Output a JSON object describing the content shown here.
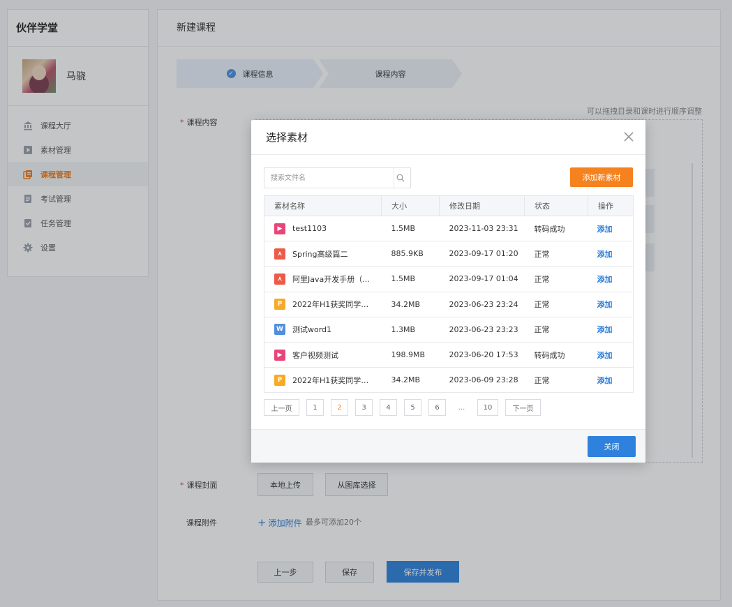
{
  "sidebar": {
    "app_title": "伙伴学堂",
    "username": "马骁",
    "items": [
      {
        "label": "课程大厅",
        "icon": "hall-icon",
        "active": false
      },
      {
        "label": "素材管理",
        "icon": "media-icon",
        "active": false
      },
      {
        "label": "课程管理",
        "icon": "course-icon",
        "active": true
      },
      {
        "label": "考试管理",
        "icon": "exam-icon",
        "active": false
      },
      {
        "label": "任务管理",
        "icon": "task-icon",
        "active": false
      },
      {
        "label": "设置",
        "icon": "gear-icon",
        "active": false
      }
    ]
  },
  "main": {
    "title": "新建课程",
    "steps": [
      "课程信息",
      "课程内容"
    ],
    "hint": "可以拖拽目录和课时进行顺序调整",
    "content_label": "课程内容",
    "cover_label": "课程封面",
    "cover_buttons": [
      "本地上传",
      "从图库选择"
    ],
    "attachment_label": "课程附件",
    "attachment_add": "添加附件",
    "attachment_note": "最多可添加20个",
    "prev_label": "上一步",
    "save_label": "保存",
    "publish_label": "保存并发布"
  },
  "modal": {
    "title": "选择素材",
    "search_placeholder": "搜索文件名",
    "add_button": "添加新素材",
    "columns": [
      "素材名称",
      "大小",
      "修改日期",
      "状态",
      "操作"
    ],
    "rows": [
      {
        "name": "test1103",
        "type": "video",
        "size": "1.5MB",
        "date": "2023-11-03 23:31",
        "status": "转码成功",
        "action": "添加"
      },
      {
        "name": "Spring高级篇二",
        "type": "pdf",
        "size": "885.9KB",
        "date": "2023-09-17 01:20",
        "status": "正常",
        "action": "添加"
      },
      {
        "name": "阿里Java开发手册（...",
        "type": "pdf",
        "size": "1.5MB",
        "date": "2023-09-17 01:04",
        "status": "正常",
        "action": "添加"
      },
      {
        "name": "2022年H1获奖同学事...",
        "type": "ppt",
        "size": "34.2MB",
        "date": "2023-06-23 23:24",
        "status": "正常",
        "action": "添加"
      },
      {
        "name": "测试word1",
        "type": "word",
        "size": "1.3MB",
        "date": "2023-06-23 23:23",
        "status": "正常",
        "action": "添加"
      },
      {
        "name": "客户视频测试",
        "type": "video",
        "size": "198.9MB",
        "date": "2023-06-20 17:53",
        "status": "转码成功",
        "action": "添加"
      },
      {
        "name": "2022年H1获奖同学事...",
        "type": "ppt",
        "size": "34.2MB",
        "date": "2023-06-09 23:28",
        "status": "正常",
        "action": "添加"
      }
    ],
    "pager": {
      "prev": "上一页",
      "pages": [
        "1",
        "2",
        "3",
        "4",
        "5",
        "6"
      ],
      "ellipsis": "...",
      "last": "10",
      "next": "下一页",
      "current": "2"
    },
    "close_button": "关闭"
  },
  "colors": {
    "accent_orange": "#f5821f",
    "accent_blue": "#2e82dd",
    "link_blue": "#2f7ed8",
    "video_icon": "#e8457a",
    "pdf_icon": "#ee5a48",
    "ppt_icon": "#f7a928",
    "word_icon": "#4f8fdf"
  }
}
